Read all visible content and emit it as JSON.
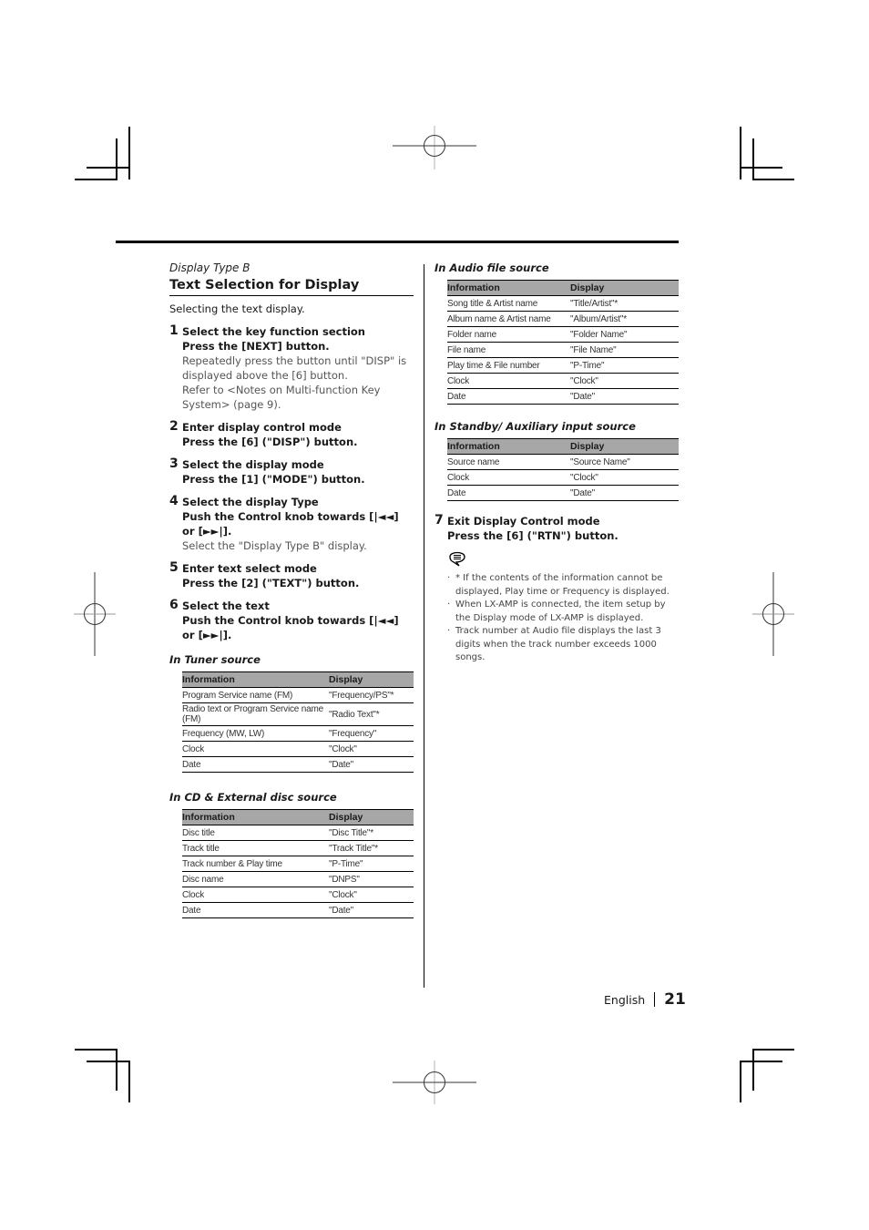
{
  "section_label": "Display Type B",
  "title": "Text Selection for Display",
  "intro": "Selecting the text display.",
  "steps": [
    {
      "num": "1",
      "title": "Select the key function section",
      "action": "Press the [NEXT] button.",
      "notes": [
        "Repeatedly press the button until \"DISP\" is displayed above the [6] button.",
        "Refer to <Notes on Multi-function Key System> (page 9)."
      ]
    },
    {
      "num": "2",
      "title": "Enter display control mode",
      "action": "Press the [6] (\"DISP\") button.",
      "notes": []
    },
    {
      "num": "3",
      "title": "Select the display mode",
      "action": "Press the [1] (\"MODE\") button.",
      "notes": []
    },
    {
      "num": "4",
      "title": "Select the display Type",
      "action": "Push the Control knob towards [|◄◄] or [►►|].",
      "notes": [
        "Select the \"Display Type B\" display."
      ]
    },
    {
      "num": "5",
      "title": "Enter text select mode",
      "action": "Press the [2] (\"TEXT\") button.",
      "notes": []
    },
    {
      "num": "6",
      "title": "Select the text",
      "action": "Push the Control knob towards [|◄◄] or [►►|].",
      "notes": []
    },
    {
      "num": "7",
      "title": "Exit Display Control mode",
      "action": "Press the [6] (\"RTN\") button.",
      "notes": []
    }
  ],
  "tables": {
    "tuner": {
      "heading": "In Tuner source",
      "headers": [
        "Information",
        "Display"
      ],
      "rows": [
        [
          "Program Service name (FM)",
          "\"Frequency/PS\"*"
        ],
        [
          "Radio text or Program Service name (FM)",
          "\"Radio Text\"*"
        ],
        [
          "Frequency (MW, LW)",
          "\"Frequency\""
        ],
        [
          "Clock",
          "\"Clock\""
        ],
        [
          "Date",
          "\"Date\""
        ]
      ]
    },
    "cd": {
      "heading": "In CD & External disc source",
      "headers": [
        "Information",
        "Display"
      ],
      "rows": [
        [
          "Disc title",
          "\"Disc Title\"*"
        ],
        [
          "Track title",
          "\"Track Title\"*"
        ],
        [
          "Track number & Play time",
          "\"P-Time\""
        ],
        [
          "Disc name",
          "\"DNPS\""
        ],
        [
          "Clock",
          "\"Clock\""
        ],
        [
          "Date",
          "\"Date\""
        ]
      ]
    },
    "audio": {
      "heading": "In Audio file source",
      "headers": [
        "Information",
        "Display"
      ],
      "rows": [
        [
          "Song title & Artist name",
          "\"Title/Artist\"*"
        ],
        [
          "Album name & Artist name",
          "\"Album/Artist\"*"
        ],
        [
          "Folder name",
          "\"Folder Name\""
        ],
        [
          "File name",
          "\"File Name\""
        ],
        [
          "Play time & File number",
          "\"P-Time\""
        ],
        [
          "Clock",
          "\"Clock\""
        ],
        [
          "Date",
          "\"Date\""
        ]
      ]
    },
    "standby": {
      "heading": "In Standby/ Auxiliary input source",
      "headers": [
        "Information",
        "Display"
      ],
      "rows": [
        [
          "Source name",
          "\"Source Name\""
        ],
        [
          "Clock",
          "\"Clock\""
        ],
        [
          "Date",
          "\"Date\""
        ]
      ]
    }
  },
  "notes_icon": "notes-speech-bubble-icon",
  "notes": [
    "* If the contents of the information cannot be displayed, Play time or Frequency is displayed.",
    "When LX-AMP is connected, the item setup by the Display mode of LX-AMP is displayed.",
    "Track number at Audio file displays the last 3 digits when the track number exceeds 1000 songs."
  ],
  "footer": {
    "language": "English",
    "page_number": "21"
  }
}
